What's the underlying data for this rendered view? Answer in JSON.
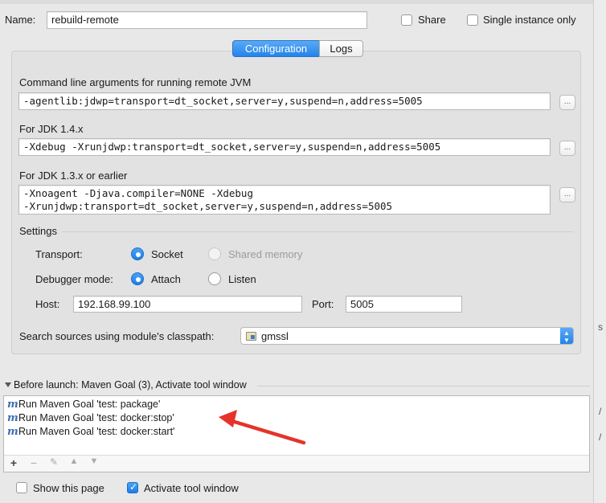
{
  "header": {
    "name_label": "Name:",
    "name_value": "rebuild-remote",
    "share_label": "Share",
    "share_checked": false,
    "single_instance_label": "Single instance only",
    "single_instance_checked": false
  },
  "tabs": [
    {
      "label": "Configuration",
      "active": true
    },
    {
      "label": "Logs",
      "active": false
    }
  ],
  "config": {
    "cmd_label": "Command line arguments for running remote JVM",
    "cmd_value": "-agentlib:jdwp=transport=dt_socket,server=y,suspend=n,address=5005",
    "jdk14_label": "For JDK 1.4.x",
    "jdk14_value": "-Xdebug -Xrunjdwp:transport=dt_socket,server=y,suspend=n,address=5005",
    "jdk13_label": "For JDK 1.3.x or earlier",
    "jdk13_line1": "-Xnoagent -Djava.compiler=NONE -Xdebug",
    "jdk13_line2": "-Xrunjdwp:transport=dt_socket,server=y,suspend=n,address=5005",
    "expand_button": "...",
    "settings_label": "Settings",
    "transport_label": "Transport:",
    "transport_options": [
      {
        "label": "Socket",
        "selected": true,
        "enabled": true
      },
      {
        "label": "Shared memory",
        "selected": false,
        "enabled": false
      }
    ],
    "debugger_label": "Debugger mode:",
    "debugger_options": [
      {
        "label": "Attach",
        "selected": true
      },
      {
        "label": "Listen",
        "selected": false
      }
    ],
    "host_label": "Host:",
    "host_value": "192.168.99.100",
    "port_label": "Port:",
    "port_value": "5005",
    "classpath_label": "Search sources using module's classpath:",
    "classpath_value": "gmssl"
  },
  "before_launch": {
    "title": "Before launch: Maven Goal (3), Activate tool window",
    "items": [
      {
        "icon": "m",
        "label": "Run Maven Goal 'test: package'"
      },
      {
        "icon": "m",
        "label": "Run Maven Goal 'test: docker:stop'"
      },
      {
        "icon": "m",
        "label": "Run Maven Goal 'test: docker:start'"
      }
    ],
    "toolbar": {
      "add": "+",
      "remove": "−",
      "edit": "✎",
      "up": "▲",
      "down": "▼"
    }
  },
  "footer": {
    "show_page_label": "Show this page",
    "show_page_checked": false,
    "activate_label": "Activate tool window",
    "activate_checked": true
  },
  "colors": {
    "accent": "#2384ea",
    "annotation_arrow": "#e5332a"
  }
}
